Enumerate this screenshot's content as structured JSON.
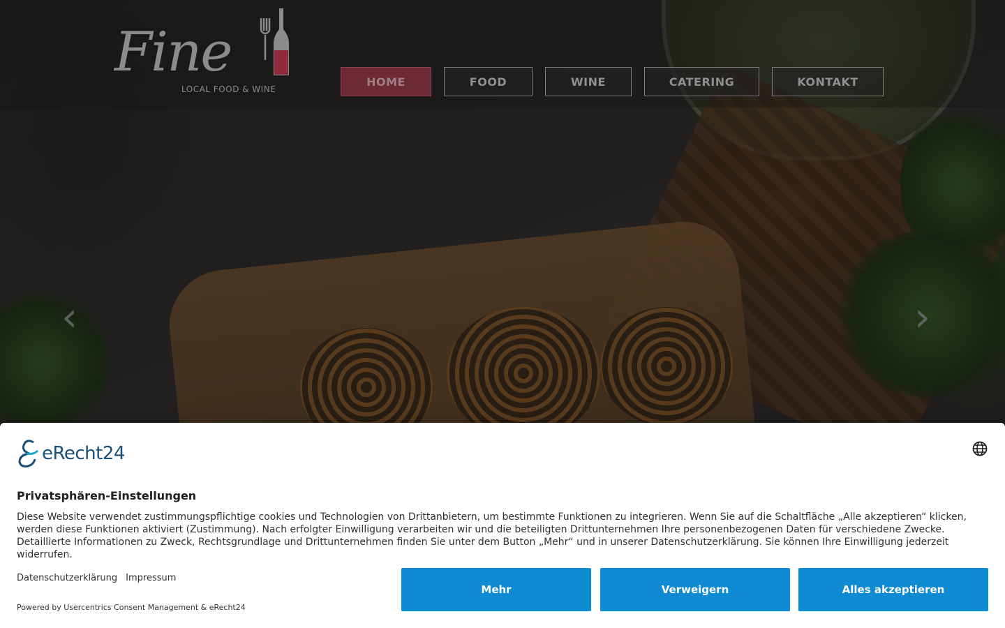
{
  "site": {
    "logo": {
      "script": "Fine",
      "tagline": "LOCAL FOOD & WINE"
    },
    "nav": [
      {
        "label": "HOME",
        "active": true
      },
      {
        "label": "FOOD",
        "active": false
      },
      {
        "label": "WINE",
        "active": false
      },
      {
        "label": "CATERING",
        "active": false
      },
      {
        "label": "KONTAKT",
        "active": false
      }
    ],
    "slider": {
      "prev_icon": "‹",
      "next_icon": "›"
    },
    "colors": {
      "nav_active": "#6b2a36"
    }
  },
  "consent": {
    "brand": "eRecht24",
    "title": "Privatsphären-Einstellungen",
    "text": "Diese Website verwendet zustimmungspflichtige cookies und Technologien von Drittanbietern, um bestimmte Funktionen zu integrieren. Wenn Sie auf die Schaltfläche „Alle akzeptieren“ klicken, werden diese Funktionen aktiviert (Zustimmung). Nach erfolgter Einwilligung verarbeiten wir und die beteiligten Drittunternehmen Ihre personenbezogenen Daten für verschiedene Zwecke. Detaillierte Informationen zu Zweck, Rechtsgrundlage und Drittunternehmen finden Sie unter dem Button „Mehr“ und in unserer Datenschutzerklärung. Sie können Ihre Einwilligung jederzeit widerrufen.",
    "links": {
      "privacy": "Datenschutzerklärung",
      "imprint": "Impressum"
    },
    "powered_by": "Powered by Usercentrics Consent Management & eRecht24",
    "buttons": {
      "more": "Mehr",
      "deny": "Verweigern",
      "accept": "Alles akzeptieren"
    },
    "colors": {
      "button": "#0f8bd4",
      "brand": "#1b4f7a"
    }
  }
}
